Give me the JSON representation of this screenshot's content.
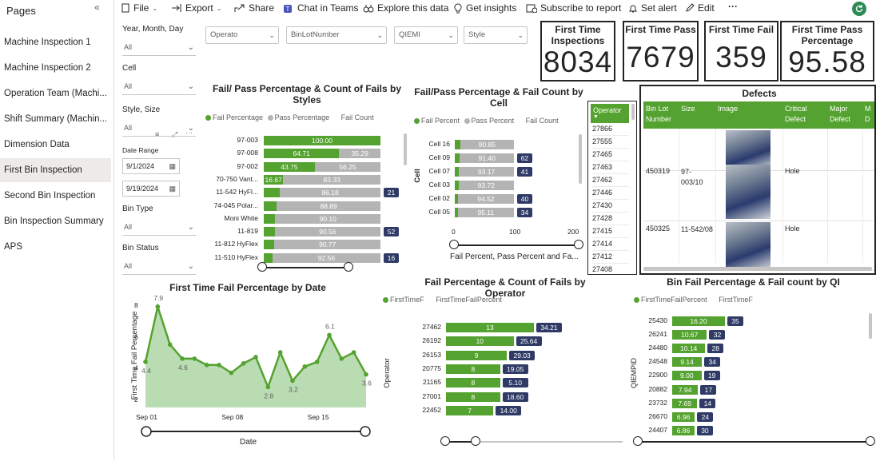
{
  "sidebar": {
    "title": "Pages",
    "collapse_icon": "«",
    "pages": [
      "Machine Inspection 1",
      "Machine Inspection 2",
      "Operation Team (Machi...",
      "Shift Summary (Machin...",
      "Dimension Data",
      "First Bin Inspection",
      "Second Bin Inspection",
      "Bin Inspection Summary",
      "APS"
    ],
    "active_index": 5
  },
  "toolbar": {
    "file": "File",
    "export": "Export",
    "share": "Share",
    "chat": "Chat in Teams",
    "explore": "Explore this data",
    "insights": "Get insights",
    "subscribe": "Subscribe to report",
    "alert": "Set alert",
    "edit": "Edit",
    "more": "···"
  },
  "slicers": {
    "ymd_label": "Year, Month, Day",
    "ymd_value": "All",
    "cell_label": "Cell",
    "cell_value": "All",
    "style_size_label": "Style, Size",
    "style_size_value": "All",
    "date_range_label": "Date Range",
    "date_start": "9/1/2024",
    "date_end": "9/19/2024",
    "bin_type_label": "Bin Type",
    "bin_type_value": "All",
    "bin_status_label": "Bin Status",
    "bin_status_value": "All",
    "top_operator": "Operato",
    "top_binlot": "BinLotNumber",
    "top_qiemi": "QIEMI",
    "top_style": "Style"
  },
  "kpis": {
    "first_time_inspections": {
      "title": "First Time Inspections",
      "value": "8034"
    },
    "first_time_pass": {
      "title": "First Time Pass",
      "value": "7679"
    },
    "first_time_fail": {
      "title": "First Time Fail",
      "value": "359"
    },
    "first_time_pass_pct": {
      "title": "First Time Pass Percentage",
      "value": "95.58"
    }
  },
  "colors": {
    "green": "#54a22f",
    "gray": "#b4b4b4",
    "navy": "#2f3a66",
    "area": "#a9d3a0"
  },
  "chart_data": [
    {
      "id": "styles",
      "type": "bar",
      "title": "Fail/ Pass Percentage & Count of Fails by Styles",
      "legend": [
        "Fail Percentage",
        "Pass Percentage",
        "Fail Count"
      ],
      "categories": [
        "97-003",
        "97-008",
        "97-002",
        "70-750 Vant...",
        "11-542 HyFl...",
        "74-045 Polar...",
        "Moni White",
        "11-819",
        "11-812 HyFlex",
        "11-510 HyFlex"
      ],
      "series": [
        {
          "name": "Fail Percentage",
          "values": [
            100.0,
            64.71,
            43.75,
            16.67,
            13.82,
            11.11,
            9.9,
            9.44,
            9.23,
            7.44
          ]
        },
        {
          "name": "Pass Percentage",
          "values": [
            0,
            35.29,
            56.25,
            83.33,
            86.18,
            88.89,
            90.1,
            90.56,
            90.77,
            92.56
          ]
        },
        {
          "name": "Fail Count",
          "values": [
            null,
            null,
            null,
            null,
            21,
            null,
            null,
            52,
            null,
            16
          ]
        }
      ],
      "labels_fail": [
        "100.00",
        "64.71",
        "43.75",
        "16.67",
        "",
        "",
        "",
        "",
        "",
        ""
      ],
      "labels_pass": [
        "",
        "35.29",
        "56.25",
        "83.33",
        "86.18",
        "88.89",
        "90.10",
        "90.56",
        "90.77",
        "92.56"
      ],
      "labels_count": [
        "",
        "",
        "",
        "",
        "21",
        "",
        "",
        "52",
        "",
        "16"
      ]
    },
    {
      "id": "cell",
      "type": "bar",
      "title": "Fail/Pass Percentage & Fail Count by Cell",
      "legend": [
        "Fail Percent",
        "Pass Percent",
        "Fail Count"
      ],
      "categories": [
        "Cell 16",
        "Cell 09",
        "Cell 07",
        "Cell 03",
        "Cell 02",
        "Cell 05"
      ],
      "series": [
        {
          "name": "Fail Percent",
          "values": [
            9.15,
            8.6,
            6.83,
            6.28,
            5.48,
            4.89
          ]
        },
        {
          "name": "Pass Percent",
          "values": [
            90.85,
            91.4,
            93.17,
            93.72,
            94.52,
            95.11
          ]
        },
        {
          "name": "Fail Count",
          "values": [
            null,
            62,
            41,
            null,
            40,
            34
          ]
        }
      ],
      "labels_pass": [
        "90.85",
        "91.40",
        "93.17",
        "93.72",
        "94.52",
        "95.11"
      ],
      "labels_count": [
        "",
        "62",
        "41",
        "",
        "40",
        "34"
      ],
      "xticks": [
        "0",
        "100",
        "200"
      ],
      "xlabel": "Fail Percent, Pass Percent and Fa...",
      "ylabel": "Cell",
      "xlim": [
        0,
        200
      ]
    },
    {
      "id": "date",
      "type": "area",
      "title": "First Time Fail Percentage by Date",
      "x": [
        "2024-09-01",
        "2024-09-02",
        "2024-09-03",
        "2024-09-04",
        "2024-09-05",
        "2024-09-06",
        "2024-09-07",
        "2024-09-08",
        "2024-09-09",
        "2024-09-10",
        "2024-09-11",
        "2024-09-12",
        "2024-09-13",
        "2024-09-14",
        "2024-09-15",
        "2024-09-16",
        "2024-09-17",
        "2024-09-18",
        "2024-09-19"
      ],
      "values": [
        4.4,
        7.9,
        5.5,
        4.6,
        4.6,
        4.2,
        4.2,
        3.7,
        4.3,
        4.7,
        2.8,
        5.0,
        3.2,
        4.1,
        4.4,
        6.1,
        4.6,
        5.0,
        3.6
      ],
      "point_labels": [
        "4.4",
        "7.9",
        "",
        "4.6",
        "",
        "",
        "",
        "",
        "",
        "",
        "2.8",
        "",
        "3.2",
        "",
        "",
        "6.1",
        "",
        "",
        "3.6"
      ],
      "yticks": [
        "2",
        "4",
        "6",
        "8"
      ],
      "ylim": [
        1.5,
        8.2
      ],
      "xticks": [
        "Sep 01",
        "Sep 08",
        "Sep 15"
      ],
      "xlabel": "Date",
      "ylabel": "First Time Fail Percentage"
    },
    {
      "id": "operator",
      "type": "bar",
      "title": "Fail Percentage & Count of Fails by Operator",
      "legend": [
        "FirstTimeF",
        "FirstTimeFailPercent"
      ],
      "categories": [
        "27462",
        "26192",
        "26153",
        "20775",
        "21165",
        "27001",
        "22452"
      ],
      "series": [
        {
          "name": "FirstTimeF",
          "values": [
            13,
            10,
            9,
            8,
            8,
            8,
            7
          ]
        },
        {
          "name": "FirstTimeFailPercent",
          "values": [
            34.21,
            25.64,
            29.03,
            19.05,
            5.1,
            18.6,
            14.0
          ]
        }
      ],
      "labels_count": [
        "13",
        "10",
        "9",
        "8",
        "8",
        "8",
        "7"
      ],
      "labels_pct": [
        "34.21",
        "25.64",
        "29.03",
        "19.05",
        "5.10",
        "18.60",
        "14.00"
      ],
      "ylabel": "Operator",
      "xmax": 13
    },
    {
      "id": "qi",
      "type": "bar",
      "title": "Bin Fail Percentage & Fail count by QI",
      "legend": [
        "FirstTimeFailPercent",
        "FirstTimeF"
      ],
      "categories": [
        "25430",
        "26241",
        "24480",
        "24548",
        "22900",
        "20882",
        "23732",
        "26670",
        "24407"
      ],
      "series": [
        {
          "name": "FirstTimeFailPercent",
          "values": [
            16.2,
            10.67,
            10.14,
            9.14,
            9.0,
            7.94,
            7.69,
            6.96,
            6.86
          ]
        },
        {
          "name": "FirstTimeF",
          "values": [
            35,
            32,
            28,
            34,
            19,
            17,
            14,
            24,
            30
          ]
        }
      ],
      "labels_pct": [
        "16.20",
        "10.67",
        "10.14",
        "9.14",
        "9.00",
        "7.94",
        "7.69",
        "6.96",
        "6.86"
      ],
      "labels_count": [
        "35",
        "32",
        "28",
        "34",
        "19",
        "17",
        "14",
        "24",
        "30"
      ],
      "ylabel": "QIEMPID",
      "xmax": 16.2
    }
  ],
  "operator_table": {
    "header": "Operator",
    "values": [
      "27866",
      "27555",
      "27465",
      "27463",
      "27462",
      "27446",
      "27430",
      "27428",
      "27415",
      "27414",
      "27412",
      "27408"
    ]
  },
  "defects": {
    "title": "Defects",
    "columns": [
      "Bin Lot Number",
      "Size",
      "Image",
      "Critical Defect",
      "Major Defect",
      "M D"
    ],
    "rows": [
      {
        "binlot": "",
        "size": "",
        "critical": "",
        "major": ""
      },
      {
        "binlot": "450319",
        "size": "97-003/10",
        "critical": "Hole",
        "major": ""
      },
      {
        "binlot": "450325",
        "size": "11-542/08",
        "critical": "Hole",
        "major": ""
      }
    ]
  }
}
